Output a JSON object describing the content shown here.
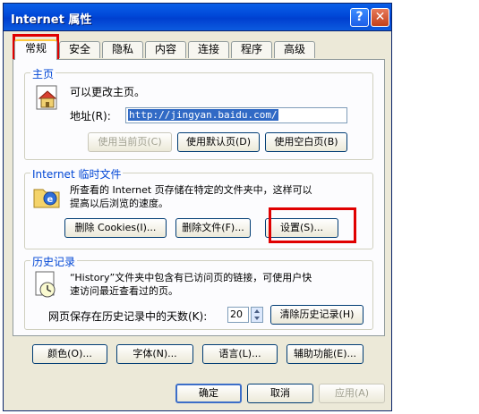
{
  "window": {
    "title": "Internet 属性",
    "help_glyph": "?",
    "close_glyph": "✕"
  },
  "tabs": [
    {
      "label": "常规"
    },
    {
      "label": "安全"
    },
    {
      "label": "隐私"
    },
    {
      "label": "内容"
    },
    {
      "label": "连接"
    },
    {
      "label": "程序"
    },
    {
      "label": "高级"
    }
  ],
  "homepage": {
    "group_title": "主页",
    "description": "可以更改主页。",
    "address_label": "地址(R):",
    "address_value": "http://jingyan.baidu.com/",
    "btn_current": "使用当前页(C)",
    "btn_default": "使用默认页(D)",
    "btn_blank": "使用空白页(B)"
  },
  "temp_files": {
    "group_title": "Internet 临时文件",
    "description_line1": "所查看的 Internet 页存储在特定的文件夹中，这样可以",
    "description_line2": "提高以后浏览的速度。",
    "btn_cookies": "删除 Cookies(I)...",
    "btn_files": "删除文件(F)...",
    "btn_settings": "设置(S)..."
  },
  "history": {
    "group_title": "历史记录",
    "description_line1": "“History”文件夹中包含有已访问页的链接，可使用户快",
    "description_line2": "速访问最近查看过的页。",
    "days_label": "网页保存在历史记录中的天数(K):",
    "days_value": "20",
    "btn_clear": "清除历史记录(H)"
  },
  "bottom_buttons": {
    "colors": "颜色(O)...",
    "fonts": "字体(N)...",
    "languages": "语言(L)...",
    "accessibility": "辅助功能(E)..."
  },
  "dialog_buttons": {
    "ok": "确定",
    "cancel": "取消",
    "apply": "应用(A)"
  },
  "colors": {
    "titlebar": "#0a5fe8",
    "highlight": "#e00000",
    "group_label": "#0046d5"
  }
}
